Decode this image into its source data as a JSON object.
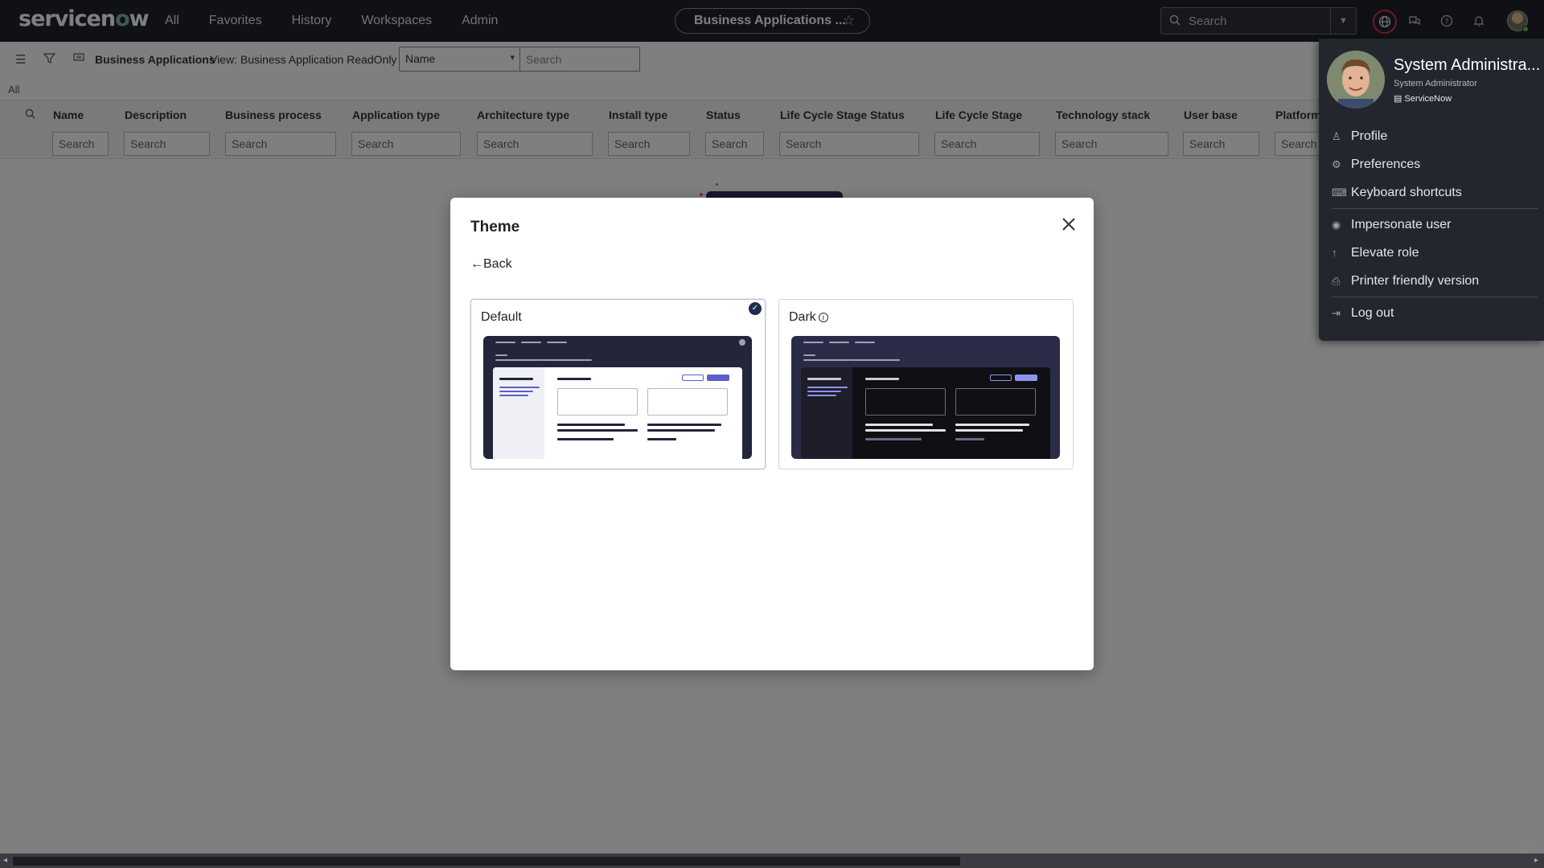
{
  "header": {
    "logo_text": "servicenow",
    "nav": [
      "All",
      "Favorites",
      "History",
      "Workspaces",
      "Admin"
    ],
    "context_pill": "Business Applications ...",
    "search_placeholder": "Search"
  },
  "list": {
    "title": "Business Applications",
    "view": "View: Business Application ReadOnly",
    "field_select": "Name",
    "search_placeholder": "Search",
    "breadcrumb": "All",
    "columns": [
      "Name",
      "Description",
      "Business process",
      "Application type",
      "Architecture type",
      "Install type",
      "Status",
      "Life Cycle Stage Status",
      "Life Cycle Stage",
      "Technology stack",
      "User base",
      "Platform"
    ],
    "filter_placeholder": "Search"
  },
  "modal": {
    "title": "Theme",
    "back_label": "Back",
    "themes": [
      {
        "label": "Default",
        "selected": true
      },
      {
        "label": "Dark",
        "selected": false
      }
    ]
  },
  "user_menu": {
    "name": "System Administra...",
    "role": "System Administrator",
    "company": "ServiceNow",
    "items": [
      "Profile",
      "Preferences",
      "Keyboard shortcuts",
      "Impersonate user",
      "Elevate role",
      "Printer friendly version",
      "Log out"
    ]
  },
  "colors": {
    "header_bg": "#1f2229",
    "accent_purple": "#5b5fc7",
    "danger_ring": "#d9364b"
  }
}
